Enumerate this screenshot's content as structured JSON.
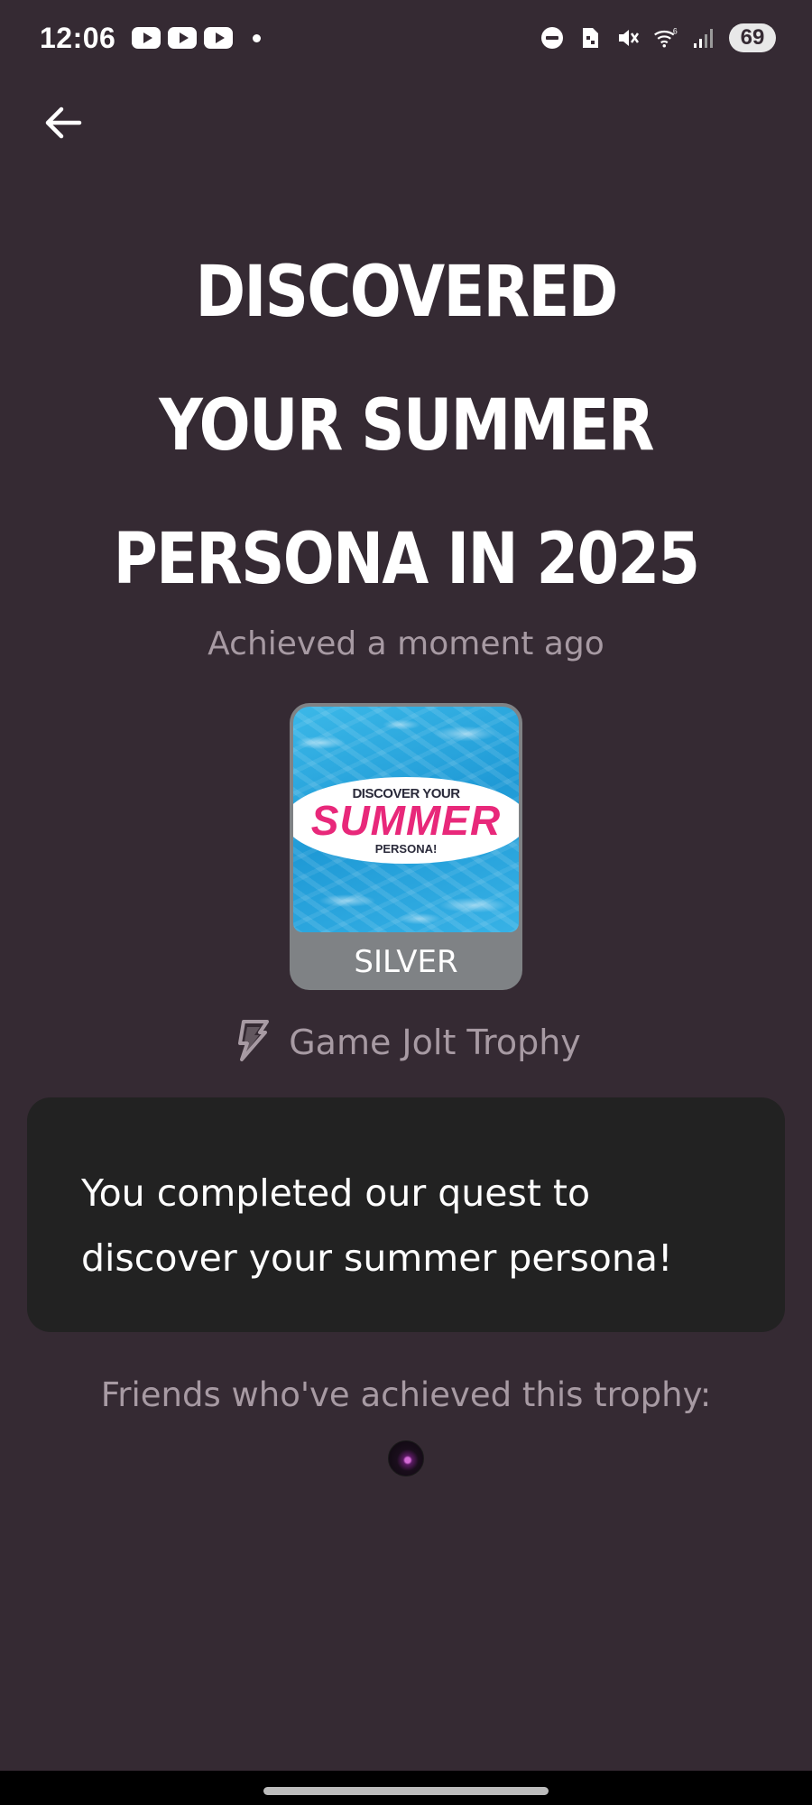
{
  "status_bar": {
    "time": "12:06",
    "notification_icons": [
      "youtube-icon",
      "youtube-icon",
      "youtube-icon"
    ],
    "system_icons": [
      "do-not-disturb-icon",
      "sim-icon",
      "mute-icon",
      "wifi-icon",
      "signal-icon"
    ],
    "wifi_badge": "6",
    "battery": "69"
  },
  "header": {
    "back_icon": "arrow-left-icon"
  },
  "trophy": {
    "title": "DISCOVERED YOUR SUMMER PERSONA IN 2025",
    "achieved": "Achieved a moment ago",
    "image_text": {
      "top": "DISCOVER YOUR",
      "main": "SUMMER",
      "bottom": "PERSONA!"
    },
    "tier": "SILVER",
    "tier_color": "#7f8285",
    "source_icon": "gamejolt-bolt-icon",
    "source": "Game Jolt Trophy",
    "description": "You completed our quest to discover your summer persona!"
  },
  "friends": {
    "label": "Friends who've achieved this trophy:",
    "avatars": [
      "avatar"
    ]
  },
  "colors": {
    "background": "#352a33",
    "card": "#222222",
    "muted_text": "#a79aa3",
    "accent_pink": "#e8287a"
  }
}
